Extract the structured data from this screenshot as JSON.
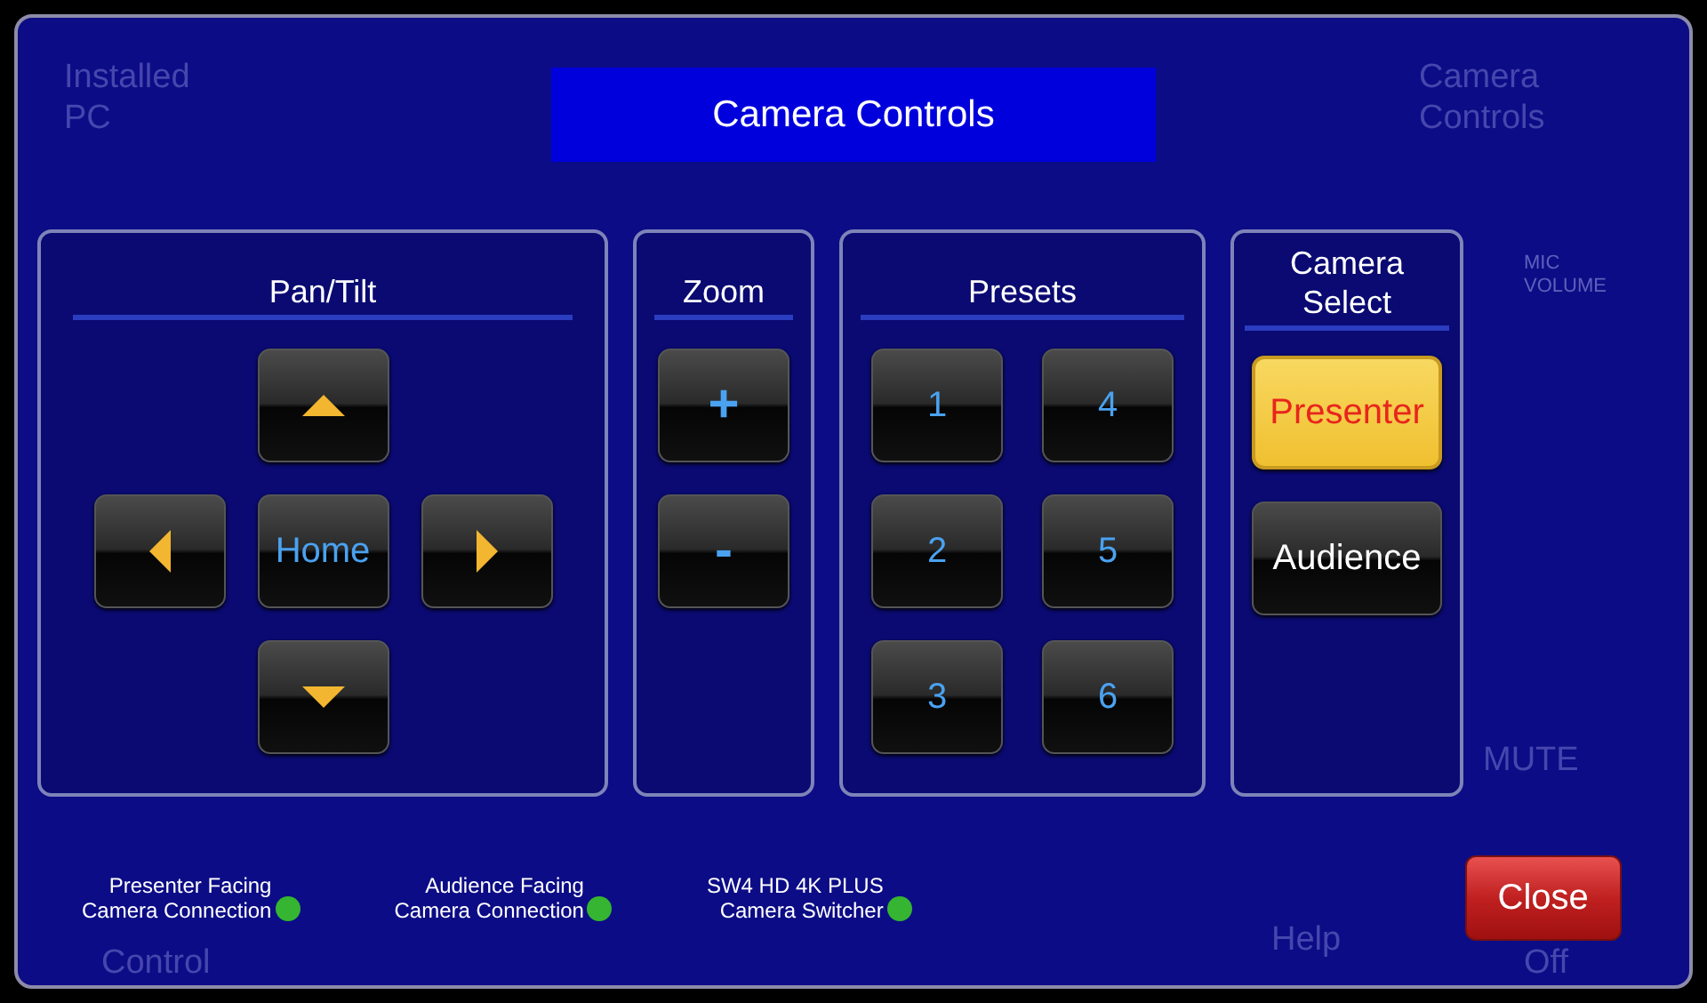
{
  "background": [
    "Installed\nPC",
    "Camera\nControls",
    "MIC\nVOLUME",
    "MUTE",
    "Help",
    "Control",
    "Off"
  ],
  "title": "Camera Controls",
  "panels": [
    {
      "kind": "dpad",
      "heading": "Pan/Tilt",
      "buttons": [
        {
          "kind": "up"
        },
        {
          "kind": "left"
        },
        {
          "kind": "text",
          "label": "Home"
        },
        {
          "kind": "right"
        },
        {
          "kind": "down"
        }
      ]
    },
    {
      "kind": "column",
      "heading": "Zoom",
      "buttons": [
        {
          "kind": "text",
          "label": "+"
        },
        {
          "kind": "text",
          "label": "-"
        }
      ]
    },
    {
      "kind": "grid",
      "heading": "Presets",
      "buttons": [
        {
          "kind": "text",
          "label": "1"
        },
        {
          "kind": "text",
          "label": "4"
        },
        {
          "kind": "text",
          "label": "2"
        },
        {
          "kind": "text",
          "label": "5"
        },
        {
          "kind": "text",
          "label": "3"
        },
        {
          "kind": "text",
          "label": "6"
        }
      ]
    },
    {
      "kind": "select",
      "heading": "Camera\nSelect",
      "buttons": [
        {
          "kind": "text",
          "label": "Presenter",
          "selected": true
        },
        {
          "kind": "text",
          "label": "Audience",
          "selected": false
        }
      ]
    }
  ],
  "status": [
    {
      "label": "Presenter Facing\nCamera Connection",
      "color": "#35b531"
    },
    {
      "label": "Audience Facing\nCamera Connection",
      "color": "#35b531"
    },
    {
      "label": "SW4 HD 4K PLUS\nCamera Switcher",
      "color": "#35b531"
    }
  ],
  "close": "Close"
}
